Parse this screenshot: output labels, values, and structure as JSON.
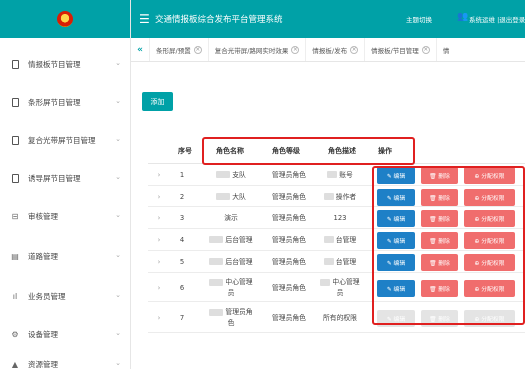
{
  "app": {
    "title": "交通情报板综合发布平台管理系统",
    "theme_label": "主题切换",
    "user_text": "系统运维 |退出登录",
    "menu_icon": "hamburger-icon"
  },
  "sidebar": {
    "items": [
      {
        "label": "情报板节目管理",
        "icon": "document-icon"
      },
      {
        "label": "条形屏节目管理",
        "icon": "document-icon"
      },
      {
        "label": "复合光带屏节目管理",
        "icon": "document-icon"
      },
      {
        "label": "诱导屏节目管理",
        "icon": "document-icon"
      },
      {
        "label": "审核管理",
        "icon": "audit-icon"
      },
      {
        "label": "道路管理",
        "icon": "road-doc-icon"
      },
      {
        "label": "业务员管理",
        "icon": "bar-chart-icon"
      },
      {
        "label": "设备管理",
        "icon": "gear-icon"
      },
      {
        "label": "资源管理",
        "icon": "resource-icon"
      }
    ]
  },
  "tabs": {
    "back_arrow": "«",
    "items": [
      {
        "label": "条形屏/预置"
      },
      {
        "label": "复合光带屏/路网实时效果"
      },
      {
        "label": "情报板/发布"
      },
      {
        "label": "情报板/节目管理"
      },
      {
        "label": "情"
      }
    ]
  },
  "toolbar": {
    "add_label": "添加"
  },
  "table": {
    "headers": {
      "index": "序号",
      "name": "角色名称",
      "level": "角色等级",
      "desc": "角色描述",
      "ops": "操作"
    },
    "actions": {
      "edit": "✎ 编辑",
      "del": "🗑 删除",
      "perm": "⊕ 分配权限"
    },
    "rows": [
      {
        "index": "1",
        "name": "支队",
        "level": "管理员角色",
        "desc": "账号"
      },
      {
        "index": "2",
        "name": "大队",
        "level": "管理员角色",
        "desc": "操作者"
      },
      {
        "index": "3",
        "name": "演示",
        "level": "管理员角色",
        "desc": "123"
      },
      {
        "index": "4",
        "name": "后台管理",
        "level": "管理员角色",
        "desc": "台管理"
      },
      {
        "index": "5",
        "name": "后台管理",
        "level": "管理员角色",
        "desc": "台管理"
      },
      {
        "index": "6",
        "name": "中心管理\n员",
        "level": "管理员角色",
        "desc": "中心管理\n员"
      },
      {
        "index": "7",
        "name": "管理员角\n色",
        "level": "管理员角色",
        "desc": "所有的权限"
      }
    ]
  },
  "colors": {
    "brand": "#00a1a7",
    "edit": "#1e80c7",
    "danger": "#f06d6d",
    "highlight": "#e02020"
  }
}
